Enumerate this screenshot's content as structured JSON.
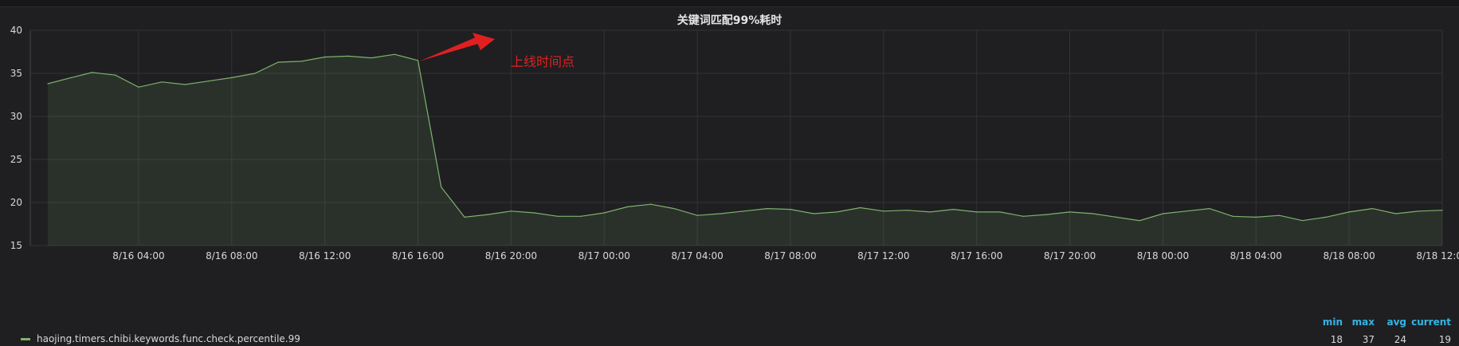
{
  "panel": {
    "title": "关键词匹配99%耗时",
    "annotation": "上线时间点"
  },
  "legend": {
    "series_name": "haojing.timers.chibi.keywords.func.check.percentile.99",
    "stats_headers": {
      "min": "min",
      "max": "max",
      "avg": "avg",
      "current": "current"
    },
    "stats_values": {
      "min": "18",
      "max": "37",
      "avg": "24",
      "current": "19"
    }
  },
  "colors": {
    "series": "#7eb26d",
    "annotation": "#e02020",
    "stats_header": "#33b5e5"
  },
  "chart_data": {
    "type": "area",
    "title": "关键词匹配99%耗时",
    "ylim": [
      15,
      40
    ],
    "yticks": [
      "15",
      "20",
      "25",
      "30",
      "35",
      "40"
    ],
    "xlim_hours": [
      -3.8,
      84
    ],
    "xticks": [
      {
        "label": "8/16 04:00",
        "h": 4
      },
      {
        "label": "8/16 08:00",
        "h": 8
      },
      {
        "label": "8/16 12:00",
        "h": 12
      },
      {
        "label": "8/16 16:00",
        "h": 16
      },
      {
        "label": "8/16 20:00",
        "h": 20
      },
      {
        "label": "8/17 00:00",
        "h": 24
      },
      {
        "label": "8/17 04:00",
        "h": 28
      },
      {
        "label": "8/17 08:00",
        "h": 32
      },
      {
        "label": "8/17 12:00",
        "h": 36
      },
      {
        "label": "8/17 16:00",
        "h": 40
      },
      {
        "label": "8/17 20:00",
        "h": 44
      },
      {
        "label": "8/18 00:00",
        "h": 48
      },
      {
        "label": "8/18 04:00",
        "h": 52
      },
      {
        "label": "8/18 08:00",
        "h": 56
      },
      {
        "label": "8/18 12:00",
        "h": 60
      }
    ],
    "grid": true,
    "series": [
      {
        "name": "haojing.timers.chibi.keywords.func.check.percentile.99",
        "x": [
          0.1,
          1.1,
          2.0,
          3.0,
          4.0,
          5.0,
          6.0,
          7.0,
          8.0,
          9.0,
          10.0,
          11.0,
          12.0,
          13.0,
          14.0,
          15.0,
          16.0,
          17.0,
          18.0,
          19.0,
          20.0,
          21.0,
          22.0,
          23.0,
          24.0,
          25.0,
          26.0,
          27.0,
          28.0,
          29.0,
          30.0,
          31.0,
          32.0,
          33.0,
          34.0,
          35.0,
          36.0,
          37.0,
          38.0,
          39.0,
          40.0,
          41.0,
          42.0,
          43.0,
          44.0,
          45.0,
          46.0,
          47.0,
          48.0,
          49.0,
          50.0,
          51.0,
          52.0,
          53.0,
          54.0,
          55.0,
          56.0,
          57.0,
          58.0,
          59.0,
          60.0
        ],
        "values": [
          33.8,
          34.5,
          35.1,
          34.8,
          33.4,
          34.0,
          33.7,
          34.1,
          34.5,
          35.0,
          36.3,
          36.4,
          36.9,
          37.0,
          36.8,
          37.2,
          36.5,
          21.8,
          18.3,
          18.6,
          19.0,
          18.8,
          18.4,
          18.4,
          18.8,
          19.5,
          19.8,
          19.3,
          18.5,
          18.7,
          19.0,
          19.3,
          19.2,
          18.7,
          18.9,
          19.4,
          19.0,
          19.1,
          18.9,
          19.2,
          18.9,
          18.9,
          18.4,
          18.6,
          18.9,
          18.7,
          18.3,
          17.9,
          18.7,
          19.0,
          19.3,
          18.4,
          18.3,
          18.5,
          17.9,
          18.3,
          18.9,
          19.3,
          18.7,
          19.0,
          19.1
        ]
      }
    ]
  }
}
